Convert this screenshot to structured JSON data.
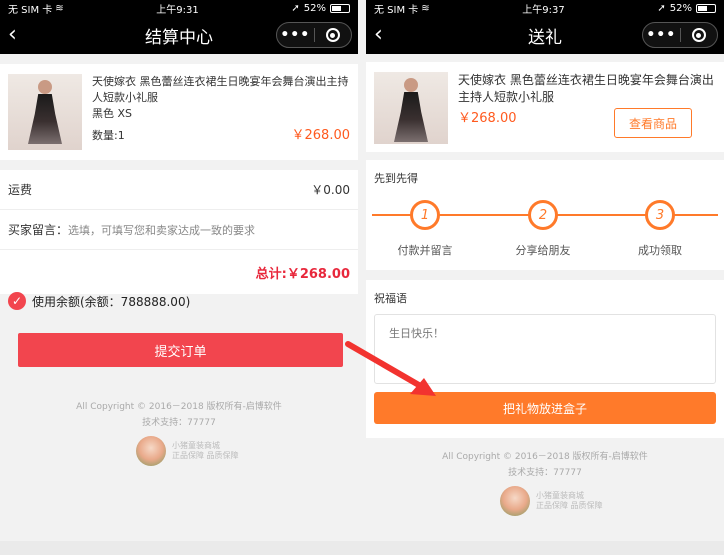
{
  "left": {
    "status": {
      "carrier": "无 SIM 卡",
      "time": "上午9:31",
      "battery": "52%"
    },
    "nav": {
      "title": "结算中心"
    },
    "product": {
      "name": "天使嫁衣 黑色蕾丝连衣裙生日晚宴年会舞台演出主持人短款小礼服",
      "spec": "黑色 XS",
      "qty": "数量:1",
      "price": "￥268.00"
    },
    "shipping": {
      "label": "运费",
      "value": "￥0.00"
    },
    "message": {
      "label": "买家留言：",
      "placeholder": "选填，可填写您和卖家达成一致的要求"
    },
    "total": {
      "label": "总计:",
      "value": "￥268.00"
    },
    "balance": {
      "label": "使用余额(余额：788888.00)"
    },
    "submit_label": "提交订单",
    "footer": {
      "copyright": "All Copyright © 2016－2018 版权所有-启博软件",
      "support": "技术支持：77777"
    },
    "logo": {
      "name": "小猪童装商城",
      "slogan": "正品保障 品质保障"
    }
  },
  "right": {
    "status": {
      "carrier": "无 SIM 卡",
      "time": "上午9:37",
      "battery": "52%"
    },
    "nav": {
      "title": "送礼"
    },
    "product": {
      "name": "天使嫁衣 黑色蕾丝连衣裙生日晚宴年会舞台演出主持人短款小礼服",
      "price": "￥268.00",
      "view_label": "查看商品"
    },
    "steps_title": "先到先得",
    "steps": [
      {
        "num": "1",
        "label": "付款并留言"
      },
      {
        "num": "2",
        "label": "分享给朋友"
      },
      {
        "num": "3",
        "label": "成功领取"
      }
    ],
    "blessing": {
      "label": "祝福语",
      "text": "生日快乐！"
    },
    "box_label": "把礼物放进盒子",
    "footer": {
      "copyright": "All Copyright © 2016－2018 版权所有-启博软件",
      "support": "技术支持：77777"
    },
    "logo": {
      "name": "小猪童装商城",
      "slogan": "正品保障 品质保障"
    }
  },
  "colors": {
    "accent_red": "#f2454e",
    "accent_orange": "#ff7a2a",
    "price_orange": "#ff5a1f",
    "total_red": "#e8283c"
  }
}
